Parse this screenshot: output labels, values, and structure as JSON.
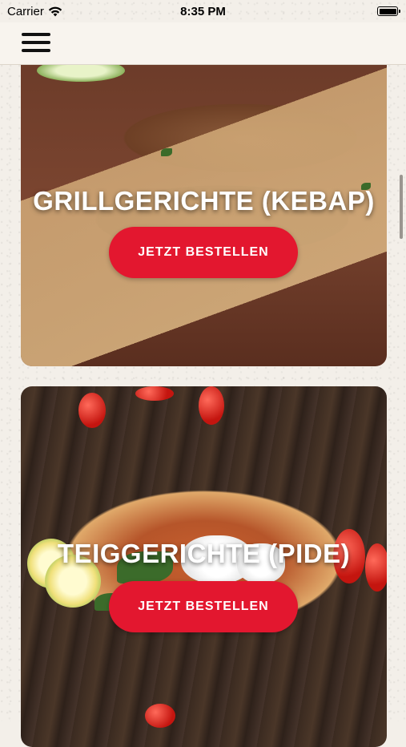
{
  "status_bar": {
    "carrier": "Carrier",
    "time": "8:35 PM"
  },
  "nav": {
    "menu_icon": "hamburger-menu-icon"
  },
  "categories": [
    {
      "title": "GRILLGERICHTE (KEBAP)",
      "button_label": "JETZT BESTELLEN"
    },
    {
      "title": "TEIGGERICHTE (PIDE)",
      "button_label": "JETZT BESTELLEN"
    }
  ],
  "colors": {
    "accent": "#e3172f",
    "background": "#f3efe9"
  }
}
